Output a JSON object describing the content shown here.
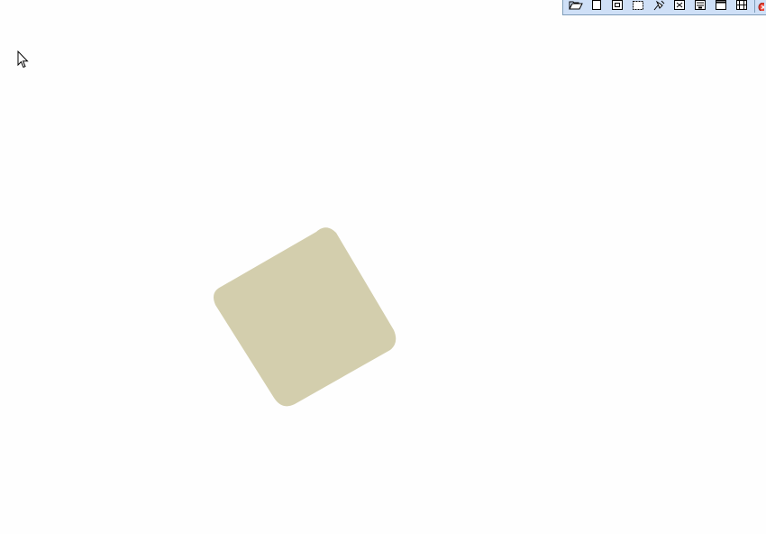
{
  "toolbar": {
    "buttons": [
      {
        "name": "open-folder-icon"
      },
      {
        "name": "page-icon"
      },
      {
        "name": "frame-icon"
      },
      {
        "name": "dashed-rect-icon"
      },
      {
        "name": "pin-icon"
      },
      {
        "name": "grid-icon"
      },
      {
        "name": "dialog-icon"
      },
      {
        "name": "window-icon"
      },
      {
        "name": "film-icon"
      }
    ],
    "accent": "#cfe0f7",
    "close_icon": "close-icon"
  },
  "canvas": {
    "background": "#fefefe",
    "shape_color": "#d3cead",
    "cursor_icon": "arrow-cursor-icon"
  }
}
